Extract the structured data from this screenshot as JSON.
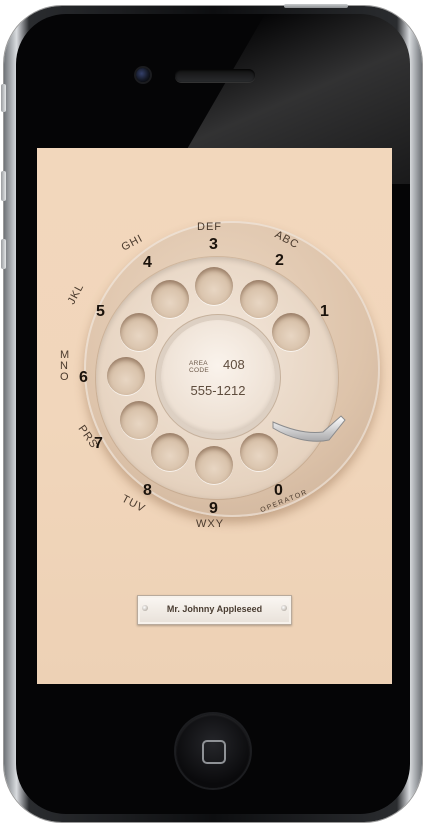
{
  "dial": {
    "area_code_label": "AREA\nCODE",
    "area_code": "408",
    "number": "555-1212",
    "digits": [
      {
        "digit": "1",
        "letters": ""
      },
      {
        "digit": "2",
        "letters": "ABC"
      },
      {
        "digit": "3",
        "letters": "DEF"
      },
      {
        "digit": "4",
        "letters": "GHI"
      },
      {
        "digit": "5",
        "letters": "JKL"
      },
      {
        "digit": "6",
        "letters": "MNO"
      },
      {
        "digit": "7",
        "letters": "PRS"
      },
      {
        "digit": "8",
        "letters": "TUV"
      },
      {
        "digit": "9",
        "letters": "WXY"
      },
      {
        "digit": "0",
        "letters": "OPERATOR"
      }
    ]
  },
  "nameplate": {
    "name": "Mr. Johnny Appleseed"
  },
  "colors": {
    "screen": "#f1d6bb",
    "dial": "#ddc3aa",
    "text": "#1a120b"
  }
}
